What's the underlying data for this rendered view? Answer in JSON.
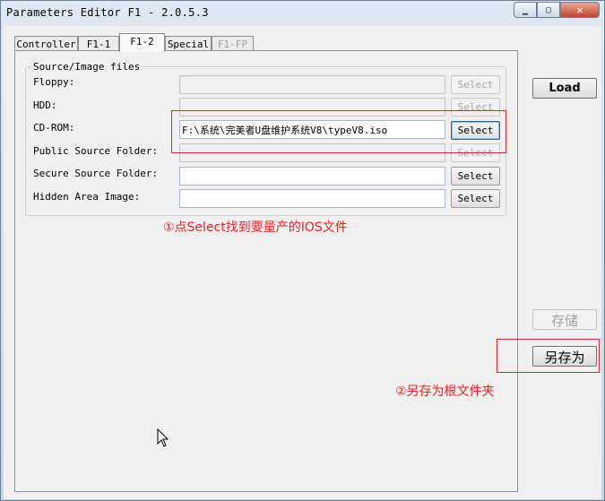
{
  "window": {
    "title": "Parameters Editor F1 - 2.0.5.3"
  },
  "tabs": [
    {
      "label": "Controller",
      "state": "normal"
    },
    {
      "label": "F1-1",
      "state": "normal"
    },
    {
      "label": "F1-2",
      "state": "active"
    },
    {
      "label": "Special",
      "state": "normal"
    },
    {
      "label": "F1-FP",
      "state": "disabled"
    }
  ],
  "group": {
    "title": "Source/Image files",
    "rows": [
      {
        "label": "Floppy:",
        "value": "",
        "button": "Select",
        "enabled": false
      },
      {
        "label": "HDD:",
        "value": "",
        "button": "Select",
        "enabled": false
      },
      {
        "label": "CD-ROM:",
        "value": "F:\\系统\\完美者U盘维护系统V8\\typeV8.iso",
        "button": "Select",
        "enabled": true
      },
      {
        "label": "Public Source Folder:",
        "value": "",
        "button": "Select",
        "enabled": false
      },
      {
        "label": "Secure Source Folder:",
        "value": "",
        "button": "Select",
        "enabled": true
      },
      {
        "label": "Hidden Area Image:",
        "value": "",
        "button": "Select",
        "enabled": true
      }
    ]
  },
  "side_buttons": {
    "load": "Load",
    "save": "存储",
    "save_as": "另存为"
  },
  "annotations": {
    "step1": "①点Select找到要量产的IOS文件",
    "step2": "②另存为根文件夹"
  },
  "colors": {
    "annotation": "#ec2323",
    "titlebar": "#c9d9ea"
  }
}
